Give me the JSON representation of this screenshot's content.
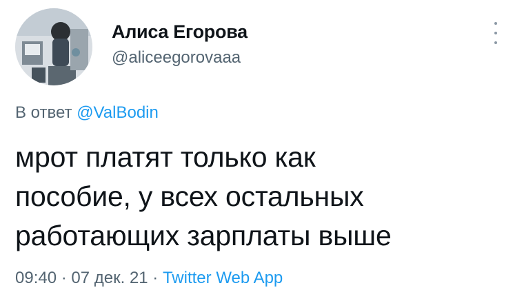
{
  "author": {
    "display_name": "Алиса Егорова",
    "handle": "@aliceegorovaaa"
  },
  "reply": {
    "prefix": "В ответ",
    "mention": "@ValBodin"
  },
  "tweet": {
    "line1": "мрот платят только как",
    "line2": "пособие, у всех остальных",
    "line3": "работающих зарплаты выше"
  },
  "meta": {
    "time": "09:40",
    "separator1": " · ",
    "date": "07 дек. 21",
    "separator2": " · ",
    "client": "Twitter Web App"
  },
  "icons": {
    "avatar": "user-avatar",
    "more": "more-options-icon"
  },
  "colors": {
    "text": "#0f1419",
    "secondary": "#536471",
    "link": "#1d9bf0"
  }
}
